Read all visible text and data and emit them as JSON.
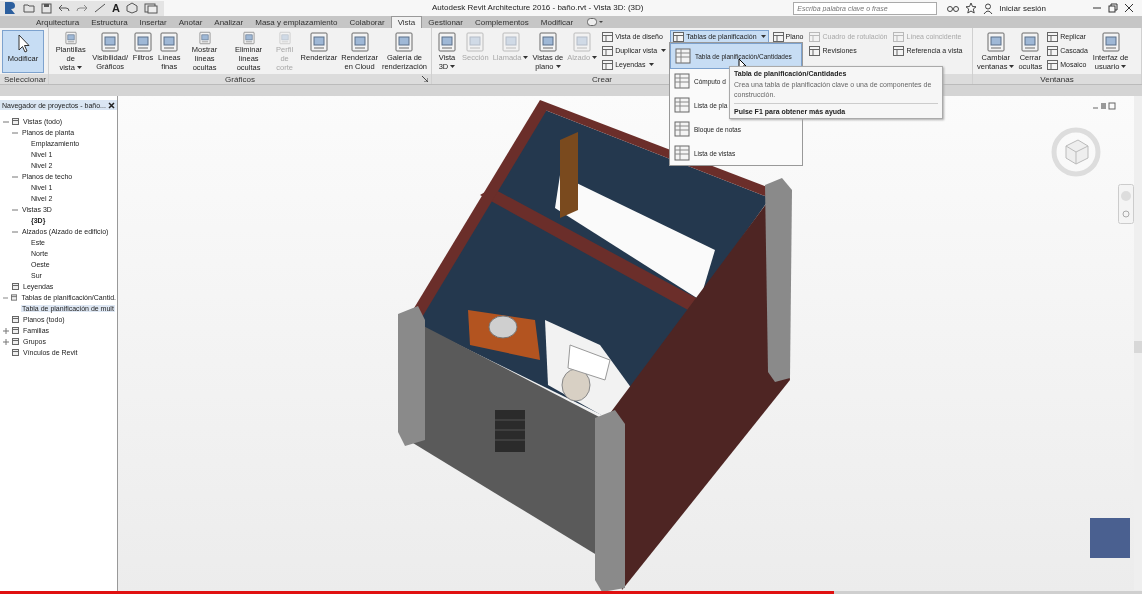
{
  "title_bar": {
    "text_tool": "A",
    "title": "Autodesk Revit Architecture 2016 - baño.rvt - Vista 3D: (3D)",
    "search": {
      "placeholder": "Escriba palabra clave o frase"
    },
    "sign_in": "Iniciar sesión"
  },
  "tabs": [
    {
      "label": "Arquitectura",
      "selected": false
    },
    {
      "label": "Estructura",
      "selected": false
    },
    {
      "label": "Insertar",
      "selected": false
    },
    {
      "label": "Anotar",
      "selected": false
    },
    {
      "label": "Analizar",
      "selected": false
    },
    {
      "label": "Masa y emplazamiento",
      "selected": false
    },
    {
      "label": "Colaborar",
      "selected": false
    },
    {
      "label": "Vista",
      "selected": true
    },
    {
      "label": "Gestionar",
      "selected": false
    },
    {
      "label": "Complementos",
      "selected": false
    },
    {
      "label": "Modificar",
      "selected": false
    }
  ],
  "ribbon": {
    "panels": [
      {
        "label": "Seleccionar",
        "menu": true,
        "launcher": false,
        "items": [
          {
            "kind": "large",
            "label": "Modificar",
            "active": true,
            "disabled": false,
            "menu": false
          }
        ]
      },
      {
        "label": "Gráficos",
        "menu": false,
        "launcher": true,
        "items": [
          {
            "kind": "large",
            "label": "Plantillas de\nvista",
            "active": false,
            "disabled": false,
            "menu": true
          },
          {
            "kind": "large",
            "label": "Visibilidad/\nGráficos",
            "active": false,
            "disabled": false,
            "menu": false
          },
          {
            "kind": "large",
            "label": "Filtros",
            "active": false,
            "disabled": false,
            "menu": false
          },
          {
            "kind": "large",
            "label": "Líneas\nfinas",
            "active": false,
            "disabled": false,
            "menu": false
          },
          {
            "kind": "large",
            "label": "Mostrar\nlíneas ocultas",
            "active": false,
            "disabled": false,
            "menu": false
          },
          {
            "kind": "large",
            "label": "Eliminar\nlíneas ocultas",
            "active": false,
            "disabled": false,
            "menu": false
          },
          {
            "kind": "large",
            "label": "Perfil de\ncorte",
            "active": false,
            "disabled": true,
            "menu": false
          },
          {
            "kind": "large",
            "label": "Renderizar",
            "active": false,
            "disabled": false,
            "menu": false
          },
          {
            "kind": "large",
            "label": "Renderizar\nen Cloud",
            "active": false,
            "disabled": false,
            "menu": false
          },
          {
            "kind": "large",
            "label": "Galería de\nrenderización",
            "active": false,
            "disabled": false,
            "menu": false
          }
        ]
      },
      {
        "label": "Crear",
        "menu": false,
        "launcher": false,
        "items": [
          {
            "kind": "large",
            "label": "Vista\n3D",
            "active": false,
            "disabled": false,
            "menu": true
          },
          {
            "kind": "large",
            "label": "Sección",
            "active": false,
            "disabled": true,
            "menu": false
          },
          {
            "kind": "large",
            "label": "Llamada",
            "active": false,
            "disabled": true,
            "menu": true
          },
          {
            "kind": "large",
            "label": "Vistas de\nplano",
            "active": false,
            "disabled": false,
            "menu": true
          },
          {
            "kind": "large",
            "label": "Alzado",
            "active": false,
            "disabled": true,
            "menu": true
          },
          {
            "kind": "stack",
            "items": [
              {
                "label": "Vista de diseño",
                "active": false,
                "disabled": false,
                "menu": false
              },
              {
                "label": "Duplicar vista",
                "active": false,
                "disabled": false,
                "menu": true
              },
              {
                "label": "Leyendas",
                "active": false,
                "disabled": false,
                "menu": true
              }
            ]
          },
          {
            "kind": "stack",
            "items": [
              {
                "label": "Tablas de planificación",
                "active": true,
                "disabled": false,
                "menu": true
              }
            ]
          },
          {
            "kind": "stack",
            "items": [
              {
                "label": "Plano",
                "active": false,
                "disabled": false,
                "menu": false
              }
            ]
          },
          {
            "kind": "stack",
            "items": [
              {
                "label": "Cuadro de rotulación",
                "active": false,
                "disabled": true,
                "menu": false
              },
              {
                "label": "Revisiones",
                "active": false,
                "disabled": false,
                "menu": false
              }
            ]
          },
          {
            "kind": "stack",
            "items": [
              {
                "label": "Línea coincidente",
                "active": false,
                "disabled": true,
                "menu": false
              },
              {
                "label": "Referencia a vista",
                "active": false,
                "disabled": false,
                "menu": false
              }
            ]
          }
        ]
      },
      {
        "label": "Ventanas",
        "menu": false,
        "launcher": false,
        "items": [
          {
            "kind": "large",
            "label": "Cambiar\nventanas",
            "active": false,
            "disabled": false,
            "menu": true
          },
          {
            "kind": "large",
            "label": "Cerrar\nocultas",
            "active": false,
            "disabled": false,
            "menu": false
          },
          {
            "kind": "stack",
            "items": [
              {
                "label": "Replicar",
                "active": false,
                "disabled": false,
                "menu": false
              },
              {
                "label": "Cascada",
                "active": false,
                "disabled": false,
                "menu": false
              },
              {
                "label": "Mosaico",
                "active": false,
                "disabled": false,
                "menu": false
              }
            ]
          },
          {
            "kind": "large",
            "label": "Interfaz de\nusuario",
            "active": false,
            "disabled": false,
            "menu": true
          }
        ]
      }
    ]
  },
  "dropdown_menu": {
    "items": [
      {
        "label": "Tabla de planificación/Cantidades",
        "selected": true
      },
      {
        "label": "Cómputo d",
        "selected": false
      },
      {
        "label": "Lista de pla",
        "selected": false
      },
      {
        "label": "Bloque de notas",
        "selected": false
      },
      {
        "label": "Lista de vistas",
        "selected": false
      }
    ]
  },
  "tooltip": {
    "title": "Tabla de planificación/Cantidades",
    "text": "Crea una tabla de planificación clave o una de componentes de construcción.",
    "help": "Pulse F1 para obtener más ayuda"
  },
  "project_browser": {
    "title": "Navegador de proyectos - baño...",
    "tree": [
      {
        "label": "Vistas (todo)",
        "expanded": true,
        "selected": false,
        "current": false,
        "children": [
          {
            "label": "Planos de planta",
            "expanded": true,
            "selected": false,
            "current": false,
            "children": [
              {
                "label": "Emplazamiento",
                "selected": false,
                "current": false
              },
              {
                "label": "Nivel 1",
                "selected": false,
                "current": false
              },
              {
                "label": "Nivel 2",
                "selected": false,
                "current": false
              }
            ]
          },
          {
            "label": "Planos de techo",
            "expanded": true,
            "selected": false,
            "current": false,
            "children": [
              {
                "label": "Nivel 1",
                "selected": false,
                "current": false
              },
              {
                "label": "Nivel 2",
                "selected": false,
                "current": false
              }
            ]
          },
          {
            "label": "Vistas 3D",
            "expanded": true,
            "selected": false,
            "current": false,
            "children": [
              {
                "label": "{3D}",
                "selected": false,
                "current": true
              }
            ]
          },
          {
            "label": "Alzados (Alzado de edificio)",
            "expanded": true,
            "selected": false,
            "current": false,
            "children": [
              {
                "label": "Este",
                "selected": false,
                "current": false
              },
              {
                "label": "Norte",
                "selected": false,
                "current": false
              },
              {
                "label": "Oeste",
                "selected": false,
                "current": false
              },
              {
                "label": "Sur",
                "selected": false,
                "current": false
              }
            ]
          }
        ]
      },
      {
        "label": "Leyendas",
        "selected": false,
        "current": false
      },
      {
        "label": "Tablas de planificación/Cantid.",
        "expanded": true,
        "selected": false,
        "current": false,
        "children": [
          {
            "label": "Tabla de planificación de mult",
            "selected": true,
            "current": false
          }
        ]
      },
      {
        "label": "Planos (todo)",
        "selected": false,
        "current": false
      },
      {
        "label": "Familias",
        "expanded": false,
        "selected": false,
        "current": false
      },
      {
        "label": "Grupos",
        "expanded": false,
        "selected": false,
        "current": false
      },
      {
        "label": "Vínculos de Revit",
        "selected": false,
        "current": false
      }
    ]
  },
  "video_progress": {
    "level": 0.73
  }
}
